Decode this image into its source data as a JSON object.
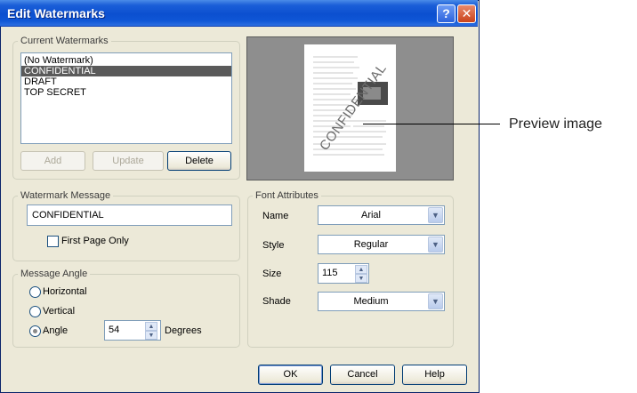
{
  "window": {
    "title": "Edit Watermarks",
    "help_glyph": "?",
    "close_glyph": "✕"
  },
  "current_watermarks": {
    "legend": "Current Watermarks",
    "items": [
      {
        "label": "(No Watermark)",
        "selected": false
      },
      {
        "label": "CONFIDENTIAL",
        "selected": true
      },
      {
        "label": "DRAFT",
        "selected": false
      },
      {
        "label": "TOP SECRET",
        "selected": false
      }
    ],
    "add_label": "Add",
    "update_label": "Update",
    "delete_label": "Delete"
  },
  "watermark_message": {
    "legend": "Watermark Message",
    "value": "CONFIDENTIAL",
    "first_page_only_label": "First Page Only",
    "first_page_only_checked": false
  },
  "message_angle": {
    "legend": "Message Angle",
    "horizontal_label": "Horizontal",
    "vertical_label": "Vertical",
    "angle_label": "Angle",
    "selected": "angle",
    "angle_value": "54",
    "degrees_label": "Degrees"
  },
  "font_attributes": {
    "legend": "Font Attributes",
    "name_label": "Name",
    "name_value": "Arial",
    "style_label": "Style",
    "style_value": "Regular",
    "size_label": "Size",
    "size_value": "115",
    "shade_label": "Shade",
    "shade_value": "Medium"
  },
  "preview": {
    "watermark_text": "CONFIDENTIAL",
    "callout_label": "Preview image"
  },
  "footer": {
    "ok_label": "OK",
    "cancel_label": "Cancel",
    "help_label": "Help"
  },
  "icons": {
    "spin_up": "▲",
    "spin_down": "▼",
    "combo_arrow": "▼"
  },
  "colors": {
    "titlebar": "#0b4fd0",
    "selection": "#5a5a5a",
    "dialog_bg": "#ece9d8",
    "preview_bg": "#8e8e8e"
  }
}
